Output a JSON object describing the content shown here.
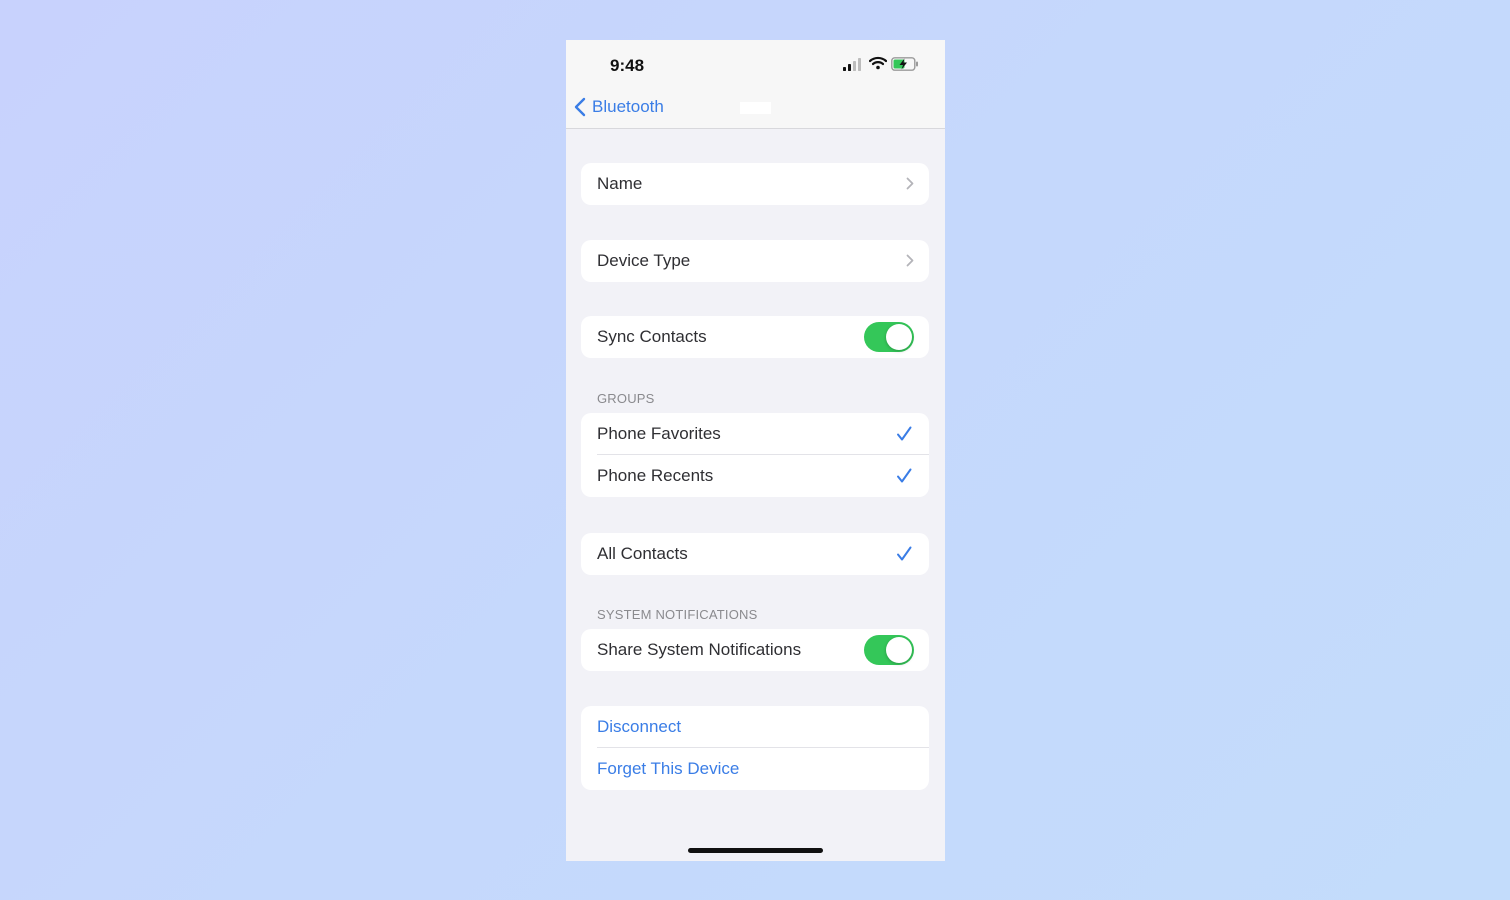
{
  "status_bar": {
    "time": "9:48"
  },
  "nav": {
    "back_label": "Bluetooth"
  },
  "rows": {
    "name": "Name",
    "device_type": "Device Type",
    "sync_contacts": "Sync Contacts",
    "phone_favorites": "Phone Favorites",
    "phone_recents": "Phone Recents",
    "all_contacts": "All Contacts",
    "share_notifications": "Share System Notifications",
    "disconnect": "Disconnect",
    "forget_device": "Forget This Device"
  },
  "sections": {
    "groups": "GROUPS",
    "system_notifications": "SYSTEM NOTIFICATIONS"
  },
  "toggles": {
    "sync_contacts": true,
    "share_notifications": true
  },
  "checks": {
    "phone_favorites": true,
    "phone_recents": true,
    "all_contacts": true
  },
  "colors": {
    "accent": "#3a7de6",
    "toggle_on": "#34c759",
    "grouped_background": "#f2f2f7"
  },
  "icons": [
    "signal-icon",
    "wifi-icon",
    "battery-charging-icon",
    "back-chevron-icon",
    "chevron-right-icon",
    "checkmark-icon"
  ]
}
